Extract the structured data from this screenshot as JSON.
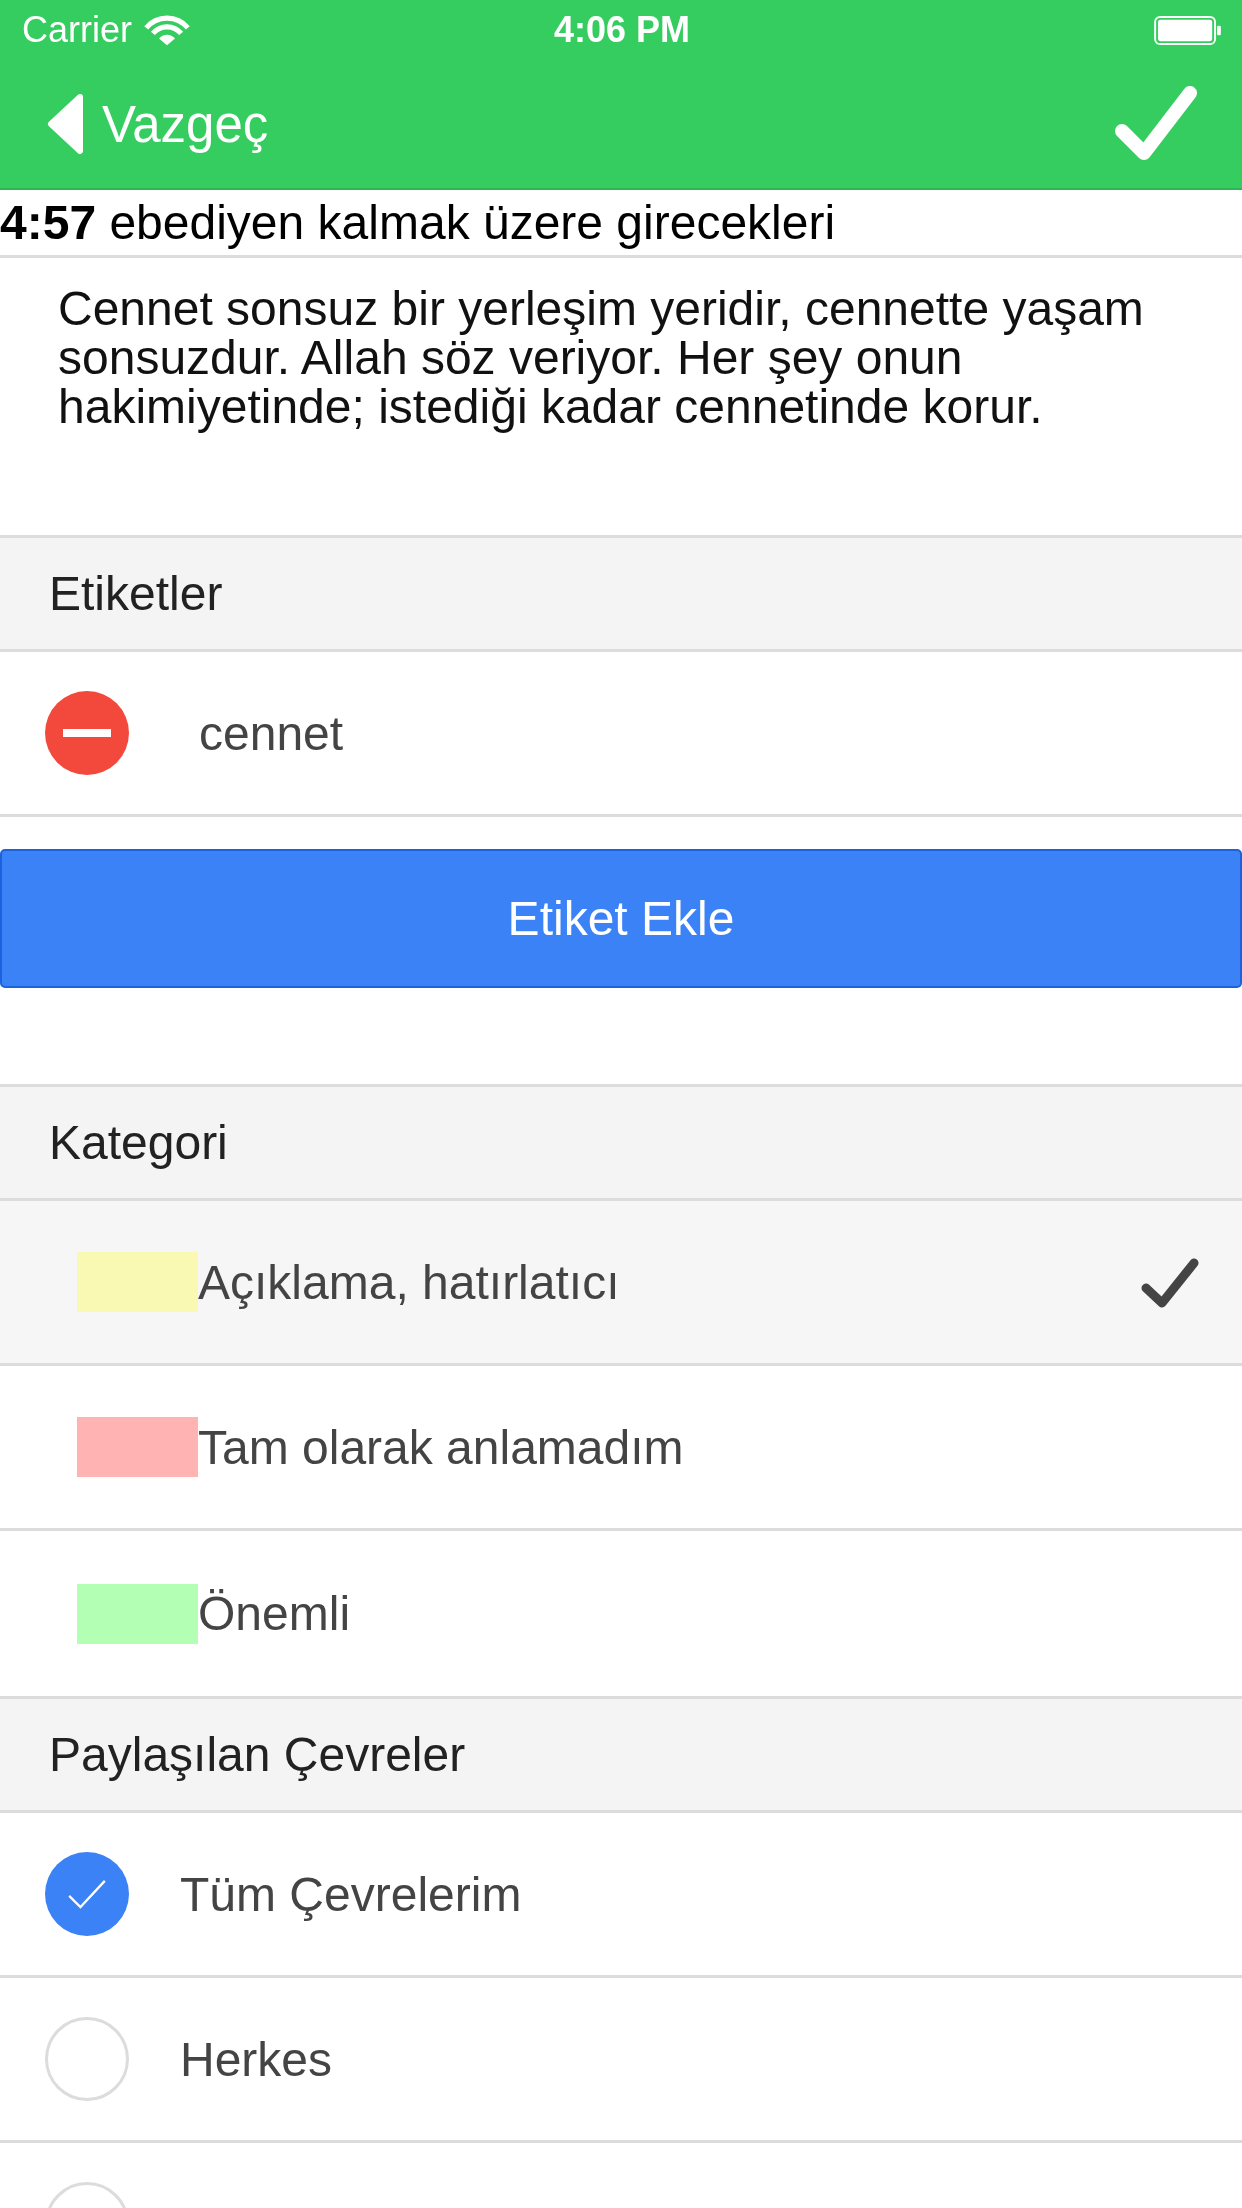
{
  "status_bar": {
    "carrier": "Carrier",
    "time": "4:06 PM"
  },
  "nav_bar": {
    "back_label": "Vazgeç"
  },
  "verse_title": "**4:57** ebediyen kalmak üzere girecekleri",
  "note": "Cennet sonsuz bir yerleşim yeridir, cennette yaşam sonsuzdur. Allah söz veriyor. Her şey onun hakimiyetinde; istediği kadar cennetinde korur.",
  "tags_section": {
    "title": "Etiketler",
    "tags": [
      {
        "label": "cennet"
      }
    ],
    "add_button": "Etiket Ekle"
  },
  "category_section": {
    "title": "Kategori",
    "categories": [
      {
        "label": "Açıklama, hatırlatıcı",
        "color": "#f9f9b3",
        "selected": true
      },
      {
        "label": "Tam olarak anlamadım",
        "color": "#ffb3b3",
        "selected": false
      },
      {
        "label": "Önemli",
        "color": "#b3ffb3",
        "selected": false
      }
    ]
  },
  "sharing_section": {
    "title": "Paylaşılan Çevreler",
    "circles": [
      {
        "label": "Tüm Çevrelerim",
        "selected": true
      },
      {
        "label": "Herkes",
        "selected": false
      },
      {
        "selected": false
      }
    ]
  }
}
